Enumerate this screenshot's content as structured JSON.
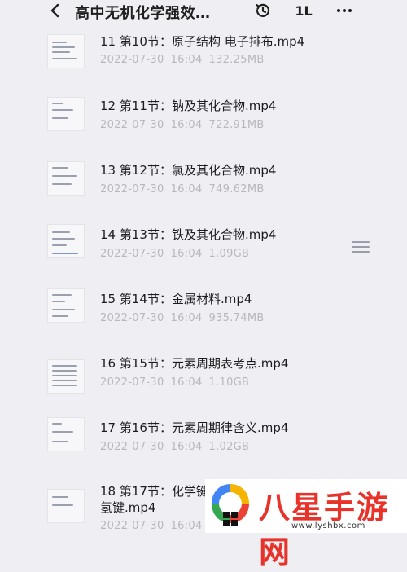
{
  "header": {
    "title": "高中无机化学强效…",
    "sort_label": "1L"
  },
  "files": [
    {
      "name": "11 第10节：原子结构 电子排布.mp4",
      "date": "2022-07-30",
      "time": "16:04",
      "size": "132.25MB"
    },
    {
      "name": "12 第11节：钠及其化合物.mp4",
      "date": "2022-07-30",
      "time": "16:04",
      "size": "722.91MB"
    },
    {
      "name": "13 第12节：氯及其化合物.mp4",
      "date": "2022-07-30",
      "time": "16:04",
      "size": "749.62MB"
    },
    {
      "name": "14 第13节：铁及其化合物.mp4",
      "date": "2022-07-30",
      "time": "16:04",
      "size": "1.09GB"
    },
    {
      "name": "15 第14节：金属材料.mp4",
      "date": "2022-07-30",
      "time": "16:04",
      "size": "935.74MB"
    },
    {
      "name": "16 第15节：元素周期表考点.mp4",
      "date": "2022-07-30",
      "time": "16:04",
      "size": "1.10GB"
    },
    {
      "name": "17 第16节：元素周期律含义.mp4",
      "date": "2022-07-30",
      "time": "16:04",
      "size": "1.02GB"
    },
    {
      "name": "18 第17节：化学键",
      "name_line2": "氢键.mp4",
      "date": "2022-07-30",
      "time": "16:04",
      "size": ""
    }
  ],
  "watermark": {
    "brand": "八星手游网",
    "url": "www.lyshbx.com"
  },
  "colors": {
    "background": "#efeff3",
    "meta_text": "#b7b7bd",
    "brand_red": "#e8332b"
  }
}
